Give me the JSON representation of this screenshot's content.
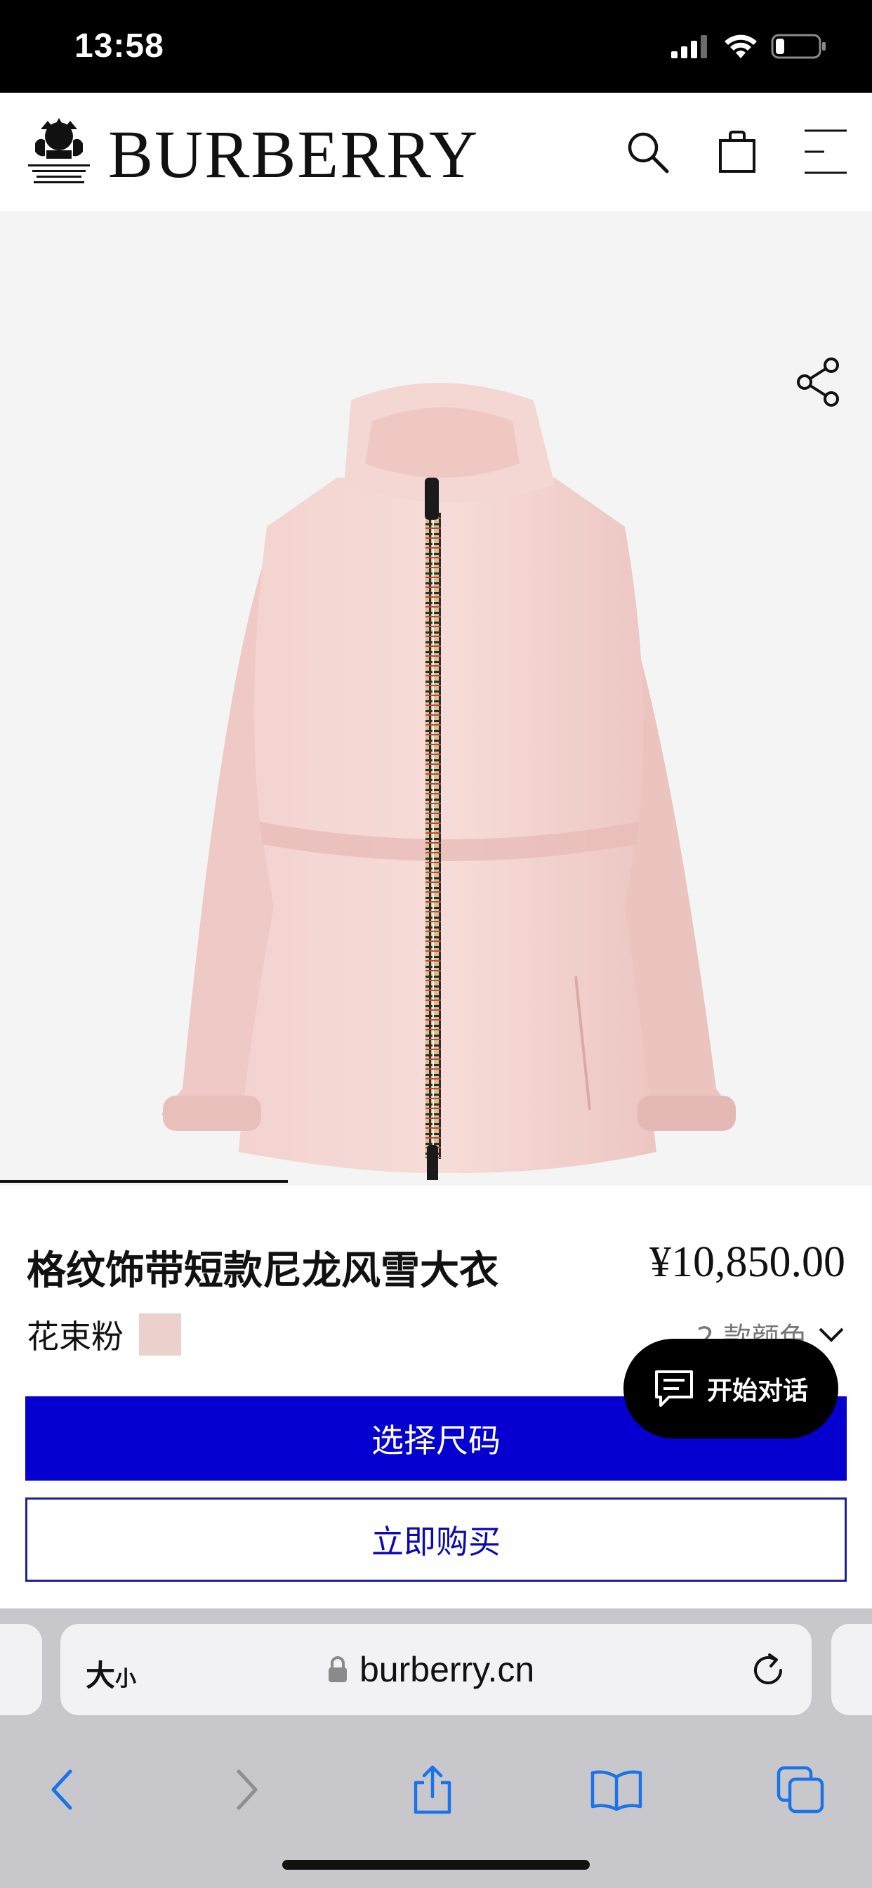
{
  "status_bar": {
    "time": "13:58"
  },
  "header": {
    "brand": "BURBERRY",
    "accent": "#000000"
  },
  "gallery": {
    "progress": 0.33
  },
  "product": {
    "title": "格纹饰带短款尼龙风雪大衣",
    "price": "¥10,850.00",
    "color_name": "花束粉",
    "swatch_color": "#ecd0cc",
    "colors_toggle": "2 款颜色"
  },
  "actions": {
    "select_size": "选择尺码",
    "buy_now": "立即购买",
    "primary_color": "#0500d0"
  },
  "chat": {
    "label": "开始对话"
  },
  "browser": {
    "text_size_big": "大",
    "text_size_small": "小",
    "url": "burberry.cn"
  }
}
